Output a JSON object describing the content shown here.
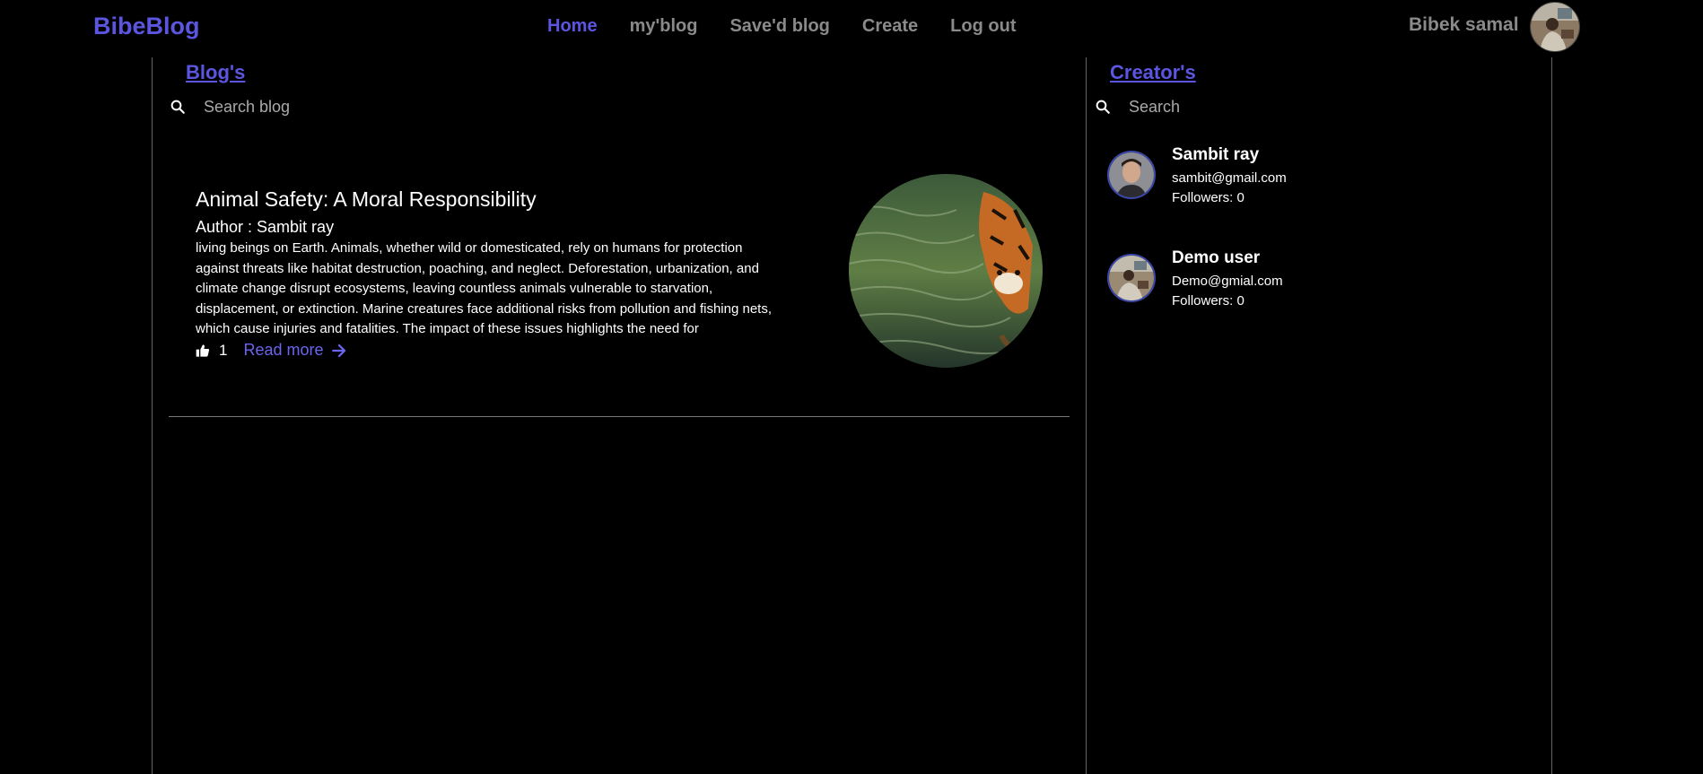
{
  "navbar": {
    "brand": "BibeBlog",
    "links": [
      {
        "label": "Home",
        "active": true
      },
      {
        "label": "my'blog"
      },
      {
        "label": "Save'd blog"
      },
      {
        "label": "Create"
      },
      {
        "label": "Log out"
      }
    ],
    "user_name": "Bibek samal",
    "avatar_icon": "user-avatar-photo"
  },
  "blogs": {
    "section_title": "Blog's",
    "search_placeholder": "Search blog",
    "posts": [
      {
        "title": "Animal Safety: A Moral Responsibility",
        "author": "Author : Sambit ray",
        "excerpt": "living beings on Earth. Animals, whether wild or domesticated, rely on humans for protection against threats like habitat destruction, poaching, and neglect. Deforestation, urbanization, and climate change disrupt ecosystems, leaving countless animals vulnerable to starvation, displacement, or extinction. Marine creatures face additional risks from pollution and fishing nets, which cause injuries and fatalities. The impact of these issues highlights the need for",
        "likes": "1",
        "read_more": "Read more",
        "image": "tiger-in-water"
      }
    ]
  },
  "creators": {
    "section_title": "Creator's",
    "search_placeholder": "Search",
    "list": [
      {
        "name": "Sambit ray",
        "email": "sambit@gmail.com",
        "followers": "Followers: 0"
      },
      {
        "name": "Demo user",
        "email": "Demo@gmial.com",
        "followers": "Followers: 0"
      }
    ]
  },
  "colors": {
    "accent": "#5b55e0",
    "nav_text": "#8a8a8a",
    "background": "#000000",
    "divider": "#666666"
  }
}
